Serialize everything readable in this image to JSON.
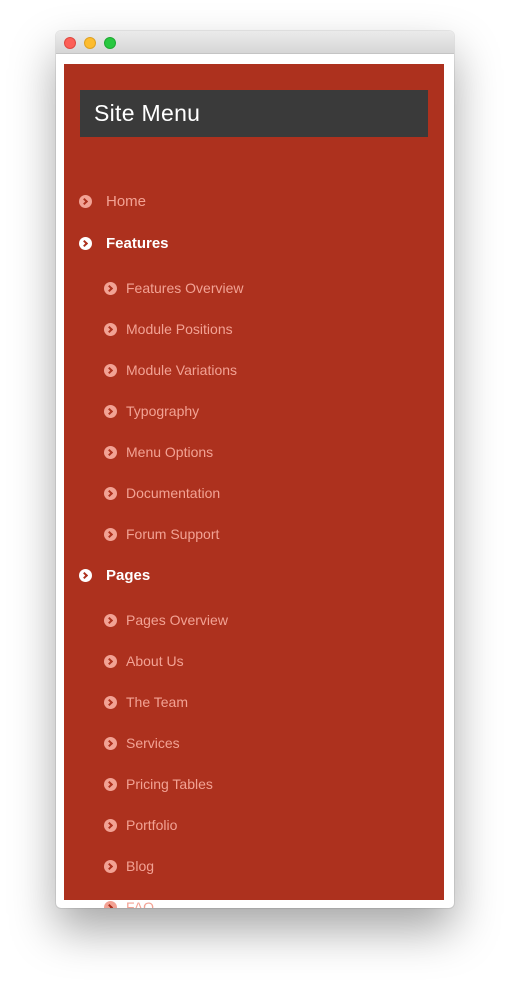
{
  "menu": {
    "title": "Site Menu",
    "home": "Home",
    "features": {
      "label": "Features",
      "items": [
        "Features Overview",
        "Module Positions",
        "Module Variations",
        "Typography",
        "Menu Options",
        "Documentation",
        "Forum Support"
      ]
    },
    "pages": {
      "label": "Pages",
      "items": [
        "Pages Overview",
        "About Us",
        "The Team",
        "Services",
        "Pricing Tables",
        "Portfolio",
        "Blog",
        "FAQ"
      ]
    }
  },
  "colors": {
    "panel": "#ad311e",
    "title_bg": "#3a3a3a",
    "link": "#f2a294",
    "active": "#ffffff"
  },
  "icons": {
    "bullet": "chevron-circle-right-icon"
  }
}
